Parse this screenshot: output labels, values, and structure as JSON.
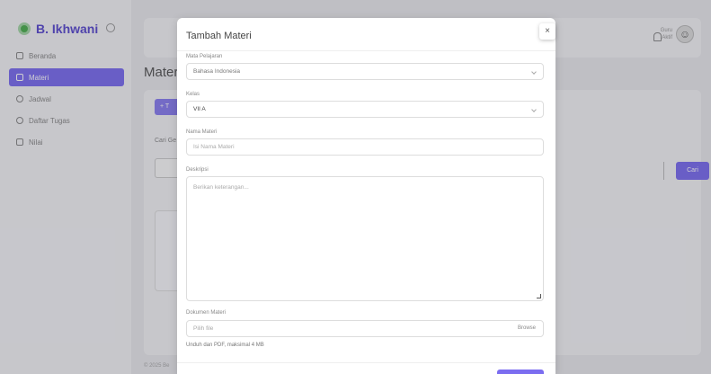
{
  "sidebar": {
    "brand": "B. Ikhwani",
    "items": [
      {
        "label": "Beranda",
        "active": false
      },
      {
        "label": "Materi",
        "active": true
      },
      {
        "label": "Jadwal",
        "active": false
      },
      {
        "label": "Daftar Tugas",
        "active": false
      },
      {
        "label": "Nilai",
        "active": false
      }
    ]
  },
  "topbar": {
    "user_name": "Guru",
    "user_role": "Aktif"
  },
  "page": {
    "title": "Materi",
    "add_button": "+ T",
    "search_label": "Cari Ge",
    "search_button": "Cari",
    "footer": "© 2025 Be"
  },
  "modal": {
    "title": "Tambah Materi",
    "close_symbol": "×",
    "fields": {
      "mapel_label": "Mata Pelajaran",
      "mapel_value": "Bahasa Indonesia",
      "kelas_label": "Kelas",
      "kelas_value": "VII A",
      "nama_label": "Nama Materi",
      "nama_placeholder": "Isi Nama Materi",
      "deskripsi_label": "Deskripsi",
      "deskripsi_placeholder": "Berikan keterangan...",
      "dokumen_label": "Dokumen Materi",
      "dokumen_placeholder": "Pilih file",
      "dokumen_browse": "Browse",
      "dokumen_help": "Unduh dan PDF, maksimal 4 MB"
    }
  },
  "colors": {
    "accent": "#7b6df0",
    "brand_text": "#5a4bcf",
    "logo": "#4caf50"
  }
}
